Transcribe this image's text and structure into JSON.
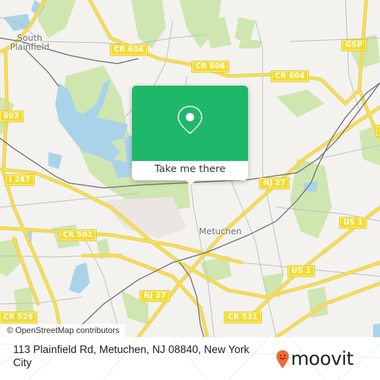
{
  "map": {
    "place_labels": [
      {
        "name": "south-plainfield",
        "lines": [
          "South",
          "Plainfield"
        ]
      },
      {
        "name": "metuchen",
        "lines": [
          "Metuchen"
        ]
      }
    ],
    "road_shields": [
      {
        "name": "cr-604-west",
        "label": "CR 604"
      },
      {
        "name": "cr-604-mid",
        "label": "CR 604"
      },
      {
        "name": "cr-604-east",
        "label": "CR 604"
      },
      {
        "name": "gsp",
        "label": "GSP"
      },
      {
        "name": "cr-603",
        "label": "603"
      },
      {
        "name": "i-287",
        "label": "I 287"
      },
      {
        "name": "nj-27-north",
        "label": "NJ 27"
      },
      {
        "name": "us-1-north",
        "label": "US 1"
      },
      {
        "name": "cr-501",
        "label": "CR 501"
      },
      {
        "name": "us-1-south",
        "label": "US 1"
      },
      {
        "name": "nj-27-south",
        "label": "NJ 27"
      },
      {
        "name": "cr-531",
        "label": "CR 531"
      },
      {
        "name": "cr-529",
        "label": "CR 529"
      },
      {
        "name": "edge-shield",
        "label": "C"
      }
    ],
    "attribution": "© OpenStreetMap contributors",
    "colors": {
      "land": "#f3f2ee",
      "park": "#cfe6b0",
      "water": "#aad3ea",
      "road_major": "#f6dd5a",
      "road_minor": "#bcbcbc",
      "rail": "#777777"
    }
  },
  "popup": {
    "icon": "location-pin-icon",
    "button_label": "Take me there",
    "accent_color": "#1fb86a"
  },
  "footer": {
    "address": "113 Plainfield Rd, Metuchen, NJ 08840, New York City",
    "brand": "moovit",
    "brand_color": "#f26a35"
  }
}
